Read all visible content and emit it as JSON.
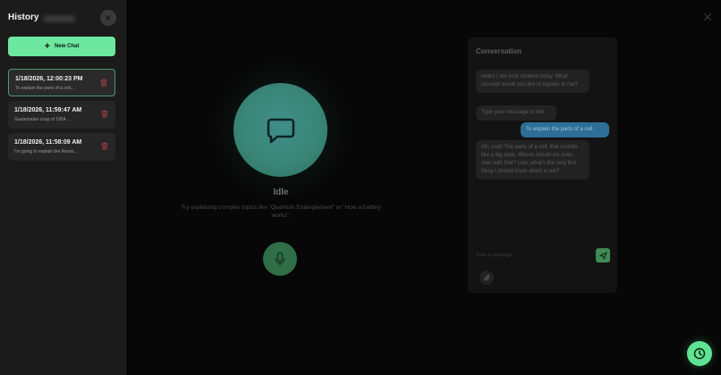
{
  "sidebar": {
    "title": "History",
    "new_chat_label": "New Chat",
    "items": [
      {
        "timestamp": "1/18/2026, 12:00:23 PM",
        "preview": "To explain the parts of a cell...",
        "active": true
      },
      {
        "timestamp": "1/18/2026, 11:59:47 AM",
        "preview": "Guatemalan coup of 1954...",
        "active": false
      },
      {
        "timestamp": "1/18/2026, 11:58:09 AM",
        "preview": "I'm going to explain the Renai...",
        "active": false
      }
    ]
  },
  "main": {
    "status_title": "Idle",
    "status_hint": "Try explaining complex topics like \"Quantum Entanglement\" or \"How a battery works\"."
  },
  "conversation": {
    "title": "Conversation",
    "messages": [
      {
        "role": "bot",
        "text": "Hello! I am your student today. What concept would you like to explain to me?"
      },
      {
        "role": "bot",
        "text": "Type your message to me!"
      },
      {
        "role": "user",
        "text": "To explain the parts of a cell."
      },
      {
        "role": "bot",
        "text": "Oh, cool! The parts of a cell, that sounds like a big topic. Where should we even start with that? Like, what's the very first thing I should know about a cell?"
      }
    ],
    "input_placeholder": "Type a message..."
  },
  "colors": {
    "accent": "#6ee7a0",
    "user_bubble": "#2d6f97",
    "orb": "#3a8676"
  },
  "icons": {
    "close": "close-icon",
    "delete": "trash-icon",
    "chat": "chat-bubble-icon",
    "mic": "microphone-icon",
    "send": "send-icon",
    "attach": "paperclip-icon",
    "history": "clock-icon"
  }
}
